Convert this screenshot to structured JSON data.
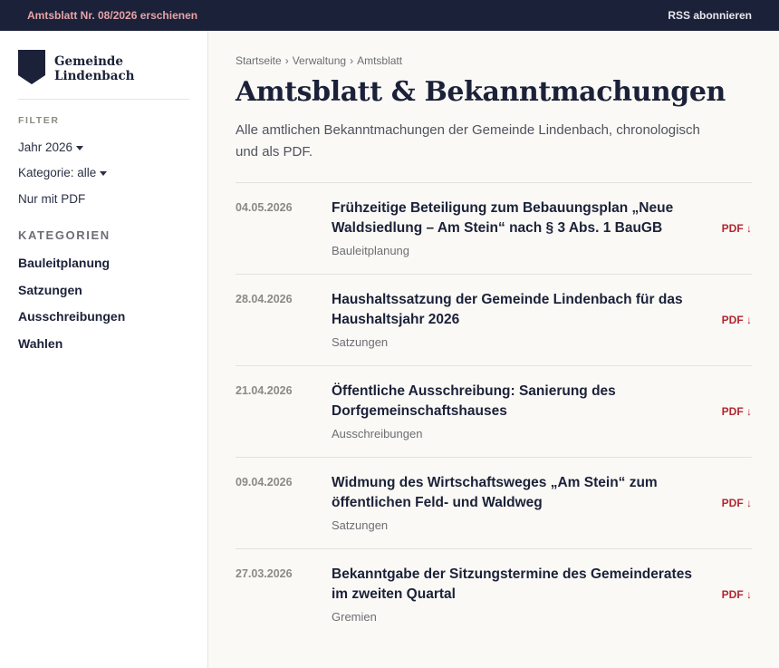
{
  "topbar": {
    "notice": "Amtsblatt Nr. 08/2026 erschienen",
    "rss": "RSS abonnieren"
  },
  "logo": {
    "line1": "Gemeinde",
    "line2": "Lindenbach"
  },
  "sidebar": {
    "filter_heading": "FILTER",
    "filters": [
      {
        "label": "Jahr 2026",
        "dropdown": true
      },
      {
        "label": "Kategorie: alle",
        "dropdown": true
      },
      {
        "label": "Nur mit PDF",
        "dropdown": false
      }
    ],
    "categories_heading": "KATEGORIEN",
    "categories": [
      "Bauleitplanung",
      "Satzungen",
      "Ausschreibungen",
      "Wahlen"
    ]
  },
  "breadcrumb": [
    "Startseite",
    "Verwaltung",
    "Amtsblatt"
  ],
  "breadcrumb_separator": "›",
  "page": {
    "title": "Amtsblatt & Bekanntmachungen",
    "intro": "Alle amtlichen Bekanntmachungen der Gemeinde Lindenbach, chronologisch und als PDF."
  },
  "announcements": [
    {
      "date": "04.05.2026",
      "title": "Frühzeitige Beteiligung zum Bebauungsplan „Neue Waldsiedlung – Am Stein“ nach § 3 Abs. 1 BauGB",
      "category": "Bauleitplanung",
      "pdf": "PDF ↓"
    },
    {
      "date": "28.04.2026",
      "title": "Haushaltssatzung der Gemeinde Lindenbach für das Haushaltsjahr 2026",
      "category": "Satzungen",
      "pdf": "PDF ↓"
    },
    {
      "date": "21.04.2026",
      "title": "Öffentliche Ausschreibung: Sanierung des Dorfgemeinschaftshauses",
      "category": "Ausschreibungen",
      "pdf": "PDF ↓"
    },
    {
      "date": "09.04.2026",
      "title": "Widmung des Wirtschaftsweges „Am Stein“ zum öffentlichen Feld- und Waldweg",
      "category": "Satzungen",
      "pdf": "PDF ↓"
    },
    {
      "date": "27.03.2026",
      "title": "Bekanntgabe der Sitzungstermine des Gemeinderates im zweiten Quartal",
      "category": "Gremien",
      "pdf": "PDF ↓"
    }
  ],
  "colors": {
    "topbar_bg": "#1b2138",
    "notice_text": "#e6a3a8",
    "accent_pdf": "#b3262e",
    "navy": "#1b2138"
  }
}
